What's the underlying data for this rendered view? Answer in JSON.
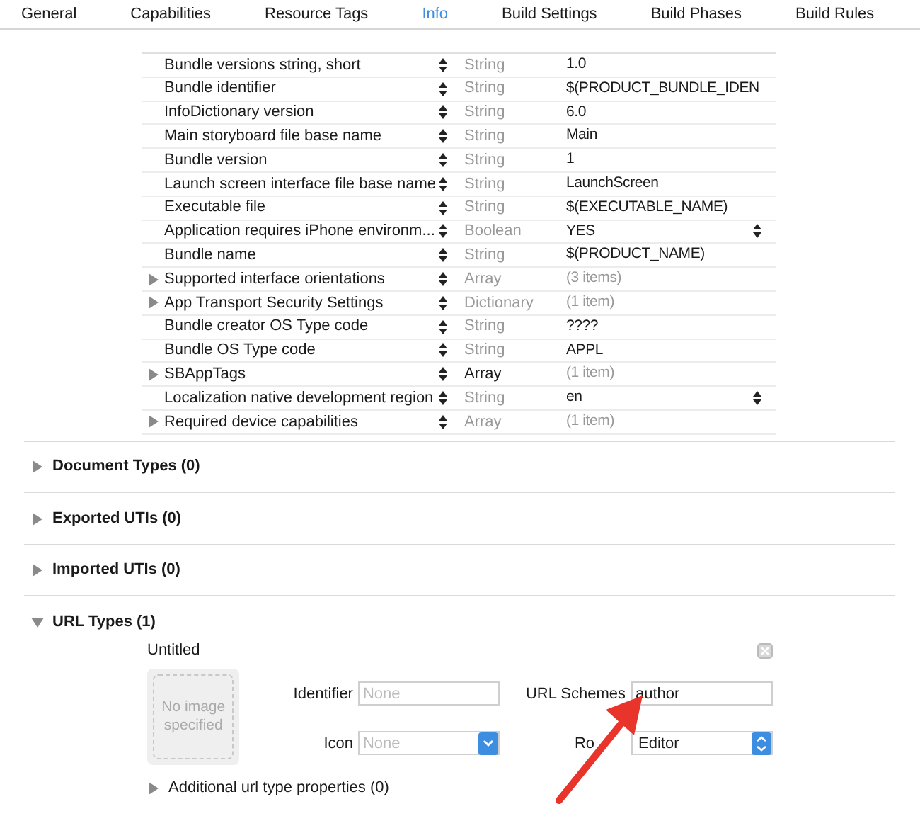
{
  "tabs": [
    {
      "label": "General",
      "selected": false
    },
    {
      "label": "Capabilities",
      "selected": false
    },
    {
      "label": "Resource Tags",
      "selected": false
    },
    {
      "label": "Info",
      "selected": true
    },
    {
      "label": "Build Settings",
      "selected": false
    },
    {
      "label": "Build Phases",
      "selected": false
    },
    {
      "label": "Build Rules",
      "selected": false
    }
  ],
  "plist_rows": [
    {
      "key": "Bundle versions string, short",
      "expandable": false,
      "type": "String",
      "type_emphasized": false,
      "value": "1.0",
      "value_muted": false,
      "value_popup": false
    },
    {
      "key": "Bundle identifier",
      "expandable": false,
      "type": "String",
      "type_emphasized": false,
      "value": "$(PRODUCT_BUNDLE_IDEN",
      "value_muted": false,
      "value_popup": false
    },
    {
      "key": "InfoDictionary version",
      "expandable": false,
      "type": "String",
      "type_emphasized": false,
      "value": "6.0",
      "value_muted": false,
      "value_popup": false
    },
    {
      "key": "Main storyboard file base name",
      "expandable": false,
      "type": "String",
      "type_emphasized": false,
      "value": "Main",
      "value_muted": false,
      "value_popup": false
    },
    {
      "key": "Bundle version",
      "expandable": false,
      "type": "String",
      "type_emphasized": false,
      "value": "1",
      "value_muted": false,
      "value_popup": false
    },
    {
      "key": "Launch screen interface file base name",
      "expandable": false,
      "type": "String",
      "type_emphasized": false,
      "value": "LaunchScreen",
      "value_muted": false,
      "value_popup": false
    },
    {
      "key": "Executable file",
      "expandable": false,
      "type": "String",
      "type_emphasized": false,
      "value": "$(EXECUTABLE_NAME)",
      "value_muted": false,
      "value_popup": false
    },
    {
      "key": "Application requires iPhone environm...",
      "expandable": false,
      "type": "Boolean",
      "type_emphasized": false,
      "value": "YES",
      "value_muted": false,
      "value_popup": true
    },
    {
      "key": "Bundle name",
      "expandable": false,
      "type": "String",
      "type_emphasized": false,
      "value": "$(PRODUCT_NAME)",
      "value_muted": false,
      "value_popup": false
    },
    {
      "key": "Supported interface orientations",
      "expandable": true,
      "type": "Array",
      "type_emphasized": false,
      "value": "(3 items)",
      "value_muted": true,
      "value_popup": false
    },
    {
      "key": "App Transport Security Settings",
      "expandable": true,
      "type": "Dictionary",
      "type_emphasized": false,
      "value": "(1 item)",
      "value_muted": true,
      "value_popup": false
    },
    {
      "key": "Bundle creator OS Type code",
      "expandable": false,
      "type": "String",
      "type_emphasized": false,
      "value": "????",
      "value_muted": false,
      "value_popup": false
    },
    {
      "key": "Bundle OS Type code",
      "expandable": false,
      "type": "String",
      "type_emphasized": false,
      "value": "APPL",
      "value_muted": false,
      "value_popup": false
    },
    {
      "key": "SBAppTags",
      "expandable": true,
      "type": "Array",
      "type_emphasized": true,
      "value": "(1 item)",
      "value_muted": true,
      "value_popup": false
    },
    {
      "key": "Localization native development region",
      "expandable": false,
      "type": "String",
      "type_emphasized": false,
      "value": "en",
      "value_muted": false,
      "value_popup": true
    },
    {
      "key": "Required device capabilities",
      "expandable": true,
      "type": "Array",
      "type_emphasized": false,
      "value": "(1 item)",
      "value_muted": true,
      "value_popup": false
    }
  ],
  "sections": [
    {
      "title": "Document Types (0)",
      "expanded": false
    },
    {
      "title": "Exported UTIs (0)",
      "expanded": false
    },
    {
      "title": "Imported UTIs (0)",
      "expanded": false
    },
    {
      "title": "URL Types (1)",
      "expanded": true
    }
  ],
  "url_type": {
    "name": "Untitled",
    "image_placeholder": "No image specified",
    "identifier_label": "Identifier",
    "identifier_placeholder": "None",
    "icon_label": "Icon",
    "icon_placeholder": "None",
    "schemes_label": "URL Schemes",
    "schemes_value": "author",
    "role_label": "Ro",
    "role_value": "Editor",
    "additional": "Additional url type properties (0)"
  }
}
